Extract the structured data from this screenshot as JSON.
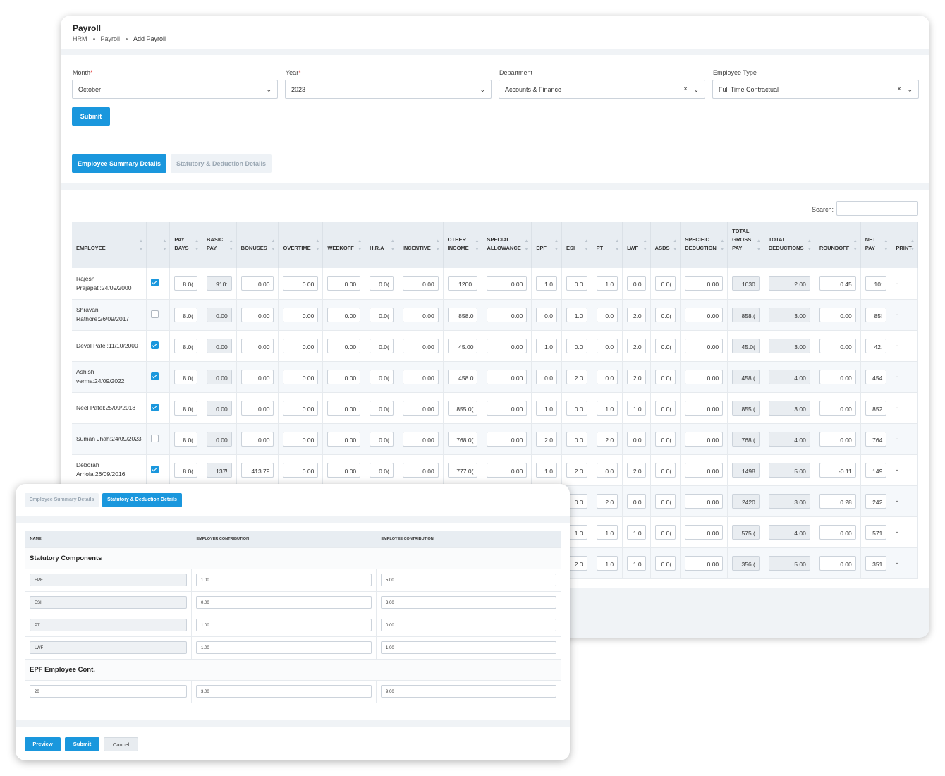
{
  "header": {
    "title": "Payroll",
    "breadcrumbs": [
      "HRM",
      "Payroll",
      "Add Payroll"
    ]
  },
  "filters": {
    "month": {
      "label": "Month",
      "value": "October"
    },
    "year": {
      "label": "Year",
      "value": "2023"
    },
    "department": {
      "label": "Department",
      "value": "Accounts & Finance"
    },
    "employee_type": {
      "label": "Employee Type",
      "value": "Full Time Contractual"
    },
    "required_mark": "*",
    "submit_label": "Submit"
  },
  "tabs": {
    "summary": "Employee Summary Details",
    "statutory": "Statutory & Deduction Details"
  },
  "search_label": "Search:",
  "table": {
    "columns": [
      "EMPLOYEE",
      "",
      "PAY DAYS",
      "BASIC PAY",
      "BONUSES",
      "OVERTIME",
      "WEEKOFF",
      "H.R.A",
      "INCENTIVE",
      "OTHER INCOME",
      "SPECIAL ALLOWANCE",
      "EPF",
      "ESI",
      "PT",
      "LWF",
      "ASDS",
      "SPECIFIC DEDUCTION",
      "TOTAL GROSS PAY",
      "TOTAL DEDUCTIONS",
      "ROUNDOFF",
      "NET PAY",
      "PRINT"
    ],
    "rows": [
      {
        "employee": "Rajesh Prajapati:24/09/2000",
        "checked": true,
        "cells": [
          "8.0(",
          "910:",
          "0.00",
          "0.00",
          "0.00",
          "0.0(",
          "0.00",
          "1200.",
          "0.00",
          "1.0",
          "0.0",
          "1.0",
          "0.0",
          "0.0(",
          "0.00",
          "1030",
          "2.00",
          "0.45",
          "10:"
        ],
        "print": "-"
      },
      {
        "employee": "Shravan Rathore:26/09/2017",
        "checked": false,
        "cells": [
          "8.0(",
          "0.00",
          "0.00",
          "0.00",
          "0.00",
          "0.0(",
          "0.00",
          "858.0",
          "0.00",
          "0.0",
          "1.0",
          "0.0",
          "2.0",
          "0.0(",
          "0.00",
          "858.(",
          "3.00",
          "0.00",
          "85!"
        ],
        "print": "-"
      },
      {
        "employee": "Deval Patel:11/10/2000",
        "checked": true,
        "cells": [
          "8.0(",
          "0.00",
          "0.00",
          "0.00",
          "0.00",
          "0.0(",
          "0.00",
          "45.00",
          "0.00",
          "1.0",
          "0.0",
          "0.0",
          "2.0",
          "0.0(",
          "0.00",
          "45.0(",
          "3.00",
          "0.00",
          "42."
        ],
        "print": "-"
      },
      {
        "employee": "Ashish verma:24/09/2022",
        "checked": true,
        "cells": [
          "8.0(",
          "0.00",
          "0.00",
          "0.00",
          "0.00",
          "0.0(",
          "0.00",
          "458.0",
          "0.00",
          "0.0",
          "2.0",
          "0.0",
          "2.0",
          "0.0(",
          "0.00",
          "458.(",
          "4.00",
          "0.00",
          "454"
        ],
        "print": "-"
      },
      {
        "employee": "Neel Patel:25/09/2018",
        "checked": true,
        "cells": [
          "8.0(",
          "0.00",
          "0.00",
          "0.00",
          "0.00",
          "0.0(",
          "0.00",
          "855.0(",
          "0.00",
          "1.0",
          "0.0",
          "1.0",
          "1.0",
          "0.0(",
          "0.00",
          "855.(",
          "3.00",
          "0.00",
          "852"
        ],
        "print": "-"
      },
      {
        "employee": "Suman Jhah:24/09/2023",
        "checked": false,
        "cells": [
          "8.0(",
          "0.00",
          "0.00",
          "0.00",
          "0.00",
          "0.0(",
          "0.00",
          "768.0(",
          "0.00",
          "2.0",
          "0.0",
          "2.0",
          "0.0",
          "0.0(",
          "0.00",
          "768.(",
          "4.00",
          "0.00",
          "764"
        ],
        "print": "-"
      },
      {
        "employee": "Deborah Arriola:26/09/2016",
        "checked": true,
        "cells": [
          "8.0(",
          "137!",
          "413.79",
          "0.00",
          "0.00",
          "0.0(",
          "0.00",
          "777.0(",
          "0.00",
          "1.0",
          "2.0",
          "0.0",
          "2.0",
          "0.0(",
          "0.00",
          "1498",
          "5.00",
          "-0.11",
          "149"
        ],
        "print": "-"
      },
      {
        "employee": "",
        "checked": null,
        "cells": [
          "",
          "",
          "",
          "",
          "",
          "",
          "",
          "",
          "",
          "",
          "0.0",
          "2.0",
          "0.0",
          "0.0(",
          "0.00",
          "2420",
          "3.00",
          "0.28",
          "242"
        ],
        "print": "-"
      },
      {
        "employee": "",
        "checked": null,
        "cells": [
          "",
          "",
          "",
          "",
          "",
          "",
          "",
          "",
          "",
          "",
          "1.0",
          "1.0",
          "1.0",
          "0.0(",
          "0.00",
          "575.(",
          "4.00",
          "0.00",
          "571"
        ],
        "print": "-"
      },
      {
        "employee": "",
        "checked": null,
        "cells": [
          "",
          "",
          "",
          "",
          "",
          "",
          "",
          "",
          "",
          "",
          "2.0",
          "1.0",
          "1.0",
          "0.0(",
          "0.00",
          "356.(",
          "5.00",
          "0.00",
          "351"
        ],
        "print": "-"
      }
    ]
  },
  "popup": {
    "tabs": {
      "summary": "Employee Summary Details",
      "statutory": "Statutory & Deduction Details"
    },
    "columns": [
      "NAME",
      "EMPLOYER CONTRIBUTION",
      "EMPLOYEE CONTRIBUTION"
    ],
    "group1": "Statutory Components",
    "components": [
      {
        "name": "EPF",
        "employer": "1.00",
        "employee": "5.00"
      },
      {
        "name": "ESI",
        "employer": "0.00",
        "employee": "3.00"
      },
      {
        "name": "PT",
        "employer": "1.00",
        "employee": "0.00"
      },
      {
        "name": "LWF",
        "employer": "1.00",
        "employee": "1.00"
      }
    ],
    "group2": "EPF Employee Cont.",
    "epf_row": {
      "name": "20",
      "employer": "3.00",
      "employee": "9.00"
    },
    "buttons": {
      "preview": "Preview",
      "submit": "Submit",
      "cancel": "Cancel"
    }
  },
  "colors": {
    "accent": "#1a97dd",
    "header_bg": "#e8edf2",
    "readonly_bg": "#e9edf1"
  }
}
